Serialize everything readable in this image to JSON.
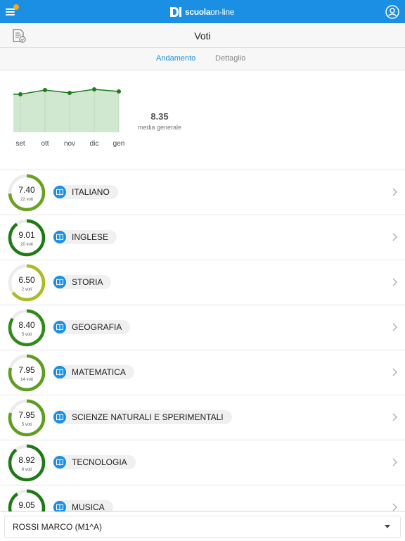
{
  "header": {
    "brand_bold": "scuola",
    "brand_light": "on-line"
  },
  "titlebar": {
    "title": "Voti"
  },
  "tabs": [
    {
      "label": "Andamento",
      "active": true
    },
    {
      "label": "Dettaglio",
      "active": false
    }
  ],
  "chart_data": {
    "type": "area",
    "categories": [
      "set",
      "ott",
      "nov",
      "dic",
      "gen"
    ],
    "values": [
      8.1,
      8.4,
      8.2,
      8.45,
      8.3
    ],
    "title": "",
    "xlabel": "",
    "ylabel": "",
    "color": "#1f7a1f",
    "fill": "#cfe8cf"
  },
  "summary": {
    "value": "8.35",
    "label": "media generale"
  },
  "subjects": [
    {
      "grade": "7.40",
      "count": "22 voti",
      "name": "ITALIANO",
      "level": 0.74,
      "color": "#6aa121"
    },
    {
      "grade": "9.01",
      "count": "20 voti",
      "name": "INGLESE",
      "level": 0.9,
      "color": "#1e7a14"
    },
    {
      "grade": "6.50",
      "count": "2 voti",
      "name": "STORIA",
      "level": 0.65,
      "color": "#a3bf24"
    },
    {
      "grade": "8.40",
      "count": "5 voti",
      "name": "GEOGRAFIA",
      "level": 0.84,
      "color": "#2f8a18"
    },
    {
      "grade": "7.95",
      "count": "14 voti",
      "name": "MATEMATICA",
      "level": 0.795,
      "color": "#5e9d1f"
    },
    {
      "grade": "7.95",
      "count": "5 voti",
      "name": "SCIENZE NATURALI E SPERIMENTALI",
      "level": 0.795,
      "color": "#5e9d1f"
    },
    {
      "grade": "8.92",
      "count": "6 voti",
      "name": "TECNOLOGIA",
      "level": 0.89,
      "color": "#1e7a14"
    },
    {
      "grade": "9.05",
      "count": "",
      "name": "MUSICA",
      "level": 0.905,
      "color": "#1e7a14"
    }
  ],
  "footer": {
    "student": "ROSSI MARCO (M1^A)"
  },
  "colors": {
    "accent": "#1a8fe3",
    "notification": "#f5a623"
  }
}
